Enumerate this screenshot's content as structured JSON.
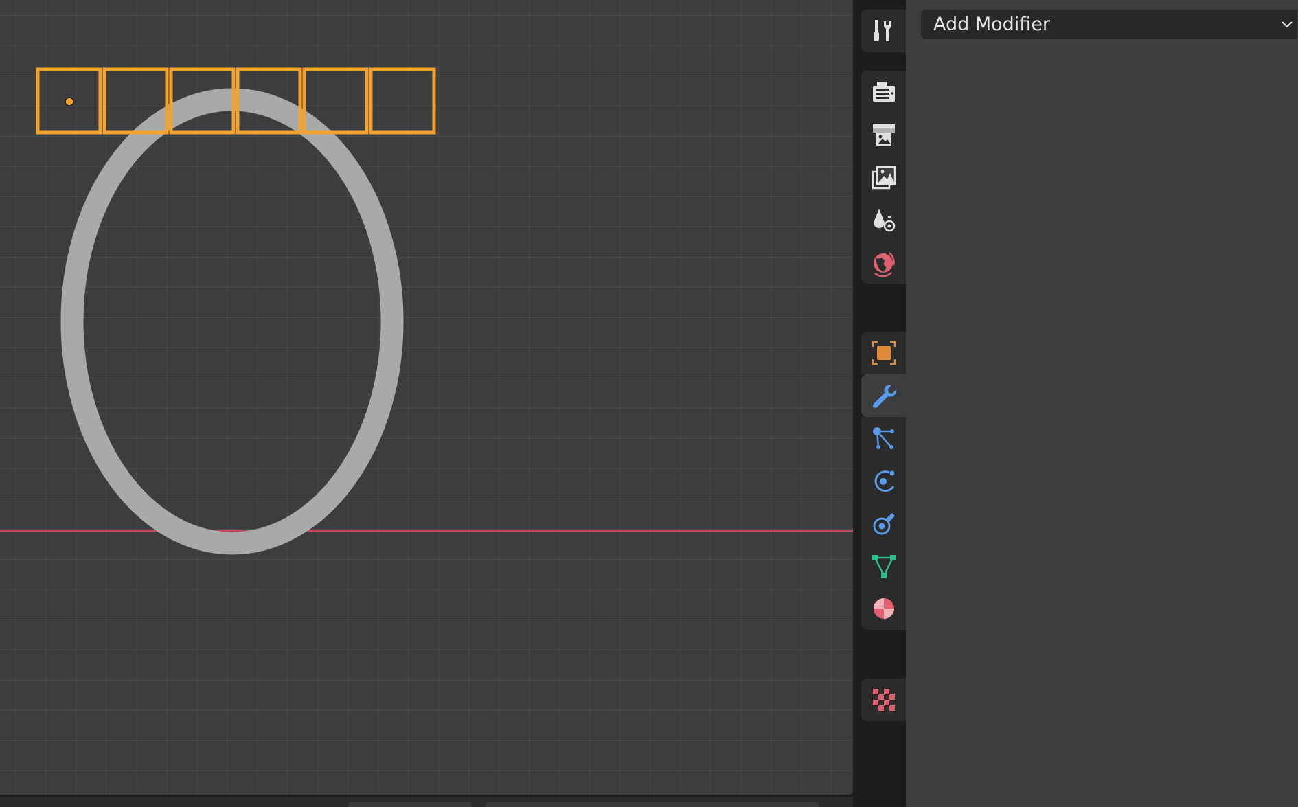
{
  "properties_panel": {
    "add_modifier_label": "Add Modifier"
  },
  "properties_tabs": [
    {
      "name": "tool",
      "icon": "tool-wrench-screwdriver-icon",
      "color": "#e0e0e0",
      "active": false
    },
    {
      "name": "render",
      "icon": "render-camera-icon",
      "color": "#e0e0e0",
      "active": false
    },
    {
      "name": "output",
      "icon": "output-printer-icon",
      "color": "#e0e0e0",
      "active": false
    },
    {
      "name": "view-layer",
      "icon": "view-layer-images-icon",
      "color": "#e0e0e0",
      "active": false
    },
    {
      "name": "scene",
      "icon": "scene-shapes-icon",
      "color": "#e0e0e0",
      "active": false
    },
    {
      "name": "world",
      "icon": "world-globe-icon",
      "color": "#e06070",
      "active": false
    },
    {
      "name": "object",
      "icon": "object-square-icon",
      "color": "#e08a3c",
      "active": false
    },
    {
      "name": "modifiers",
      "icon": "modifier-wrench-icon",
      "color": "#5a9ae8",
      "active": true
    },
    {
      "name": "particles",
      "icon": "particles-icon",
      "color": "#5a9ae8",
      "active": false
    },
    {
      "name": "physics",
      "icon": "physics-orbit-icon",
      "color": "#5a9ae8",
      "active": false
    },
    {
      "name": "constraints",
      "icon": "constraints-icon",
      "color": "#5a9ae8",
      "active": false
    },
    {
      "name": "data",
      "icon": "mesh-data-triangle-icon",
      "color": "#28c08a",
      "active": false
    },
    {
      "name": "material",
      "icon": "material-sphere-icon",
      "color": "#e06070",
      "active": false
    },
    {
      "name": "texture",
      "icon": "texture-checker-icon",
      "color": "#e06070",
      "active": false
    }
  ],
  "viewport": {
    "selection_color": "#f4a32e",
    "axis_color": "#c2475a",
    "object_color": "#a8aaa8"
  }
}
